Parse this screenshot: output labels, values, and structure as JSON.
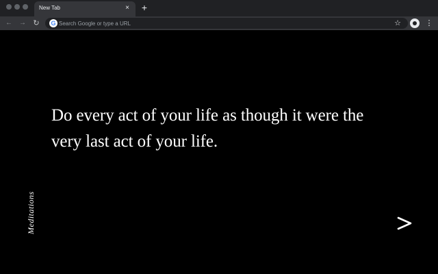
{
  "browser": {
    "tab": {
      "title": "New Tab",
      "close_glyph": "×"
    },
    "new_tab_glyph": "+",
    "toolbar": {
      "back_glyph": "←",
      "forward_glyph": "→",
      "reload_glyph": "↻",
      "omnibox_placeholder": "Search Google or type a URL",
      "google_glyph": "G",
      "star_glyph": "☆",
      "menu_glyph": "⋮"
    },
    "icons": [
      "close-icon",
      "plus-icon",
      "back-arrow-icon",
      "forward-arrow-icon",
      "reload-icon",
      "google-icon",
      "star-icon",
      "extension-icon",
      "kebab-menu-icon"
    ],
    "colors": {
      "tab_strip": "#202124",
      "toolbar": "#35363a",
      "page_background": "#000000",
      "text": "#ffffff"
    }
  },
  "page": {
    "quote": "Do every act of your life as though it were the very last act of your life.",
    "source": "Meditations",
    "next_icon": "chevron-right-icon"
  }
}
